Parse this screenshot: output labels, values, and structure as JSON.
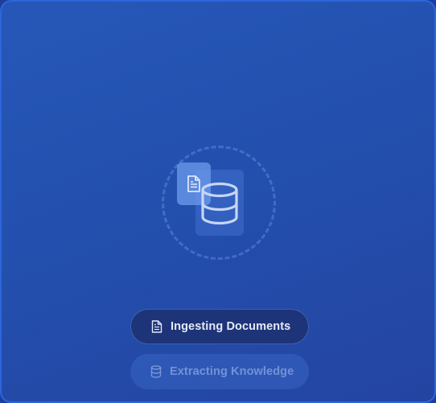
{
  "steps": [
    {
      "label": "Ingesting Documents",
      "state": "active",
      "icon": "document-icon"
    },
    {
      "label": "Extracting Knowledge",
      "state": "pending",
      "icon": "database-icon"
    }
  ],
  "illustration": {
    "icons": [
      "document-icon",
      "database-icon"
    ]
  },
  "colors": {
    "background": "#2453b0",
    "active_step": "#1e3478",
    "pending_step": "#3a6cc8"
  }
}
